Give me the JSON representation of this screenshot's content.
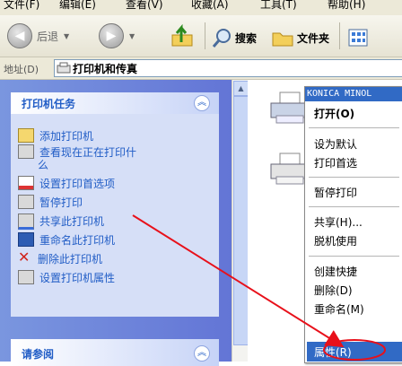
{
  "menu": {
    "file": "文件(F)",
    "edit": "编辑(E)",
    "view": "查看(V)",
    "favorites": "收藏(A)",
    "tools": "工具(T)",
    "help": "帮助(H)"
  },
  "toolbar": {
    "back": "后退",
    "search": "搜索",
    "folders": "文件夹"
  },
  "address": {
    "label": "地址(D)",
    "value": "打印机和传真"
  },
  "tasks": {
    "title": "打印机任务",
    "items": [
      {
        "label": "添加打印机"
      },
      {
        "label": "查看现在正在打印什"
      },
      {
        "label": "么"
      },
      {
        "label": "设置打印首选项"
      },
      {
        "label": "暂停打印"
      },
      {
        "label": "共享此打印机"
      },
      {
        "label": "重命名此打印机"
      },
      {
        "label": "删除此打印机"
      },
      {
        "label": "设置打印机属性"
      }
    ]
  },
  "seealso": {
    "title": "请参阅"
  },
  "context_menu": {
    "title": "KONICA MINOL",
    "items": [
      {
        "label": "打开(O)"
      },
      {
        "label": "设为默认"
      },
      {
        "label": "打印首选"
      },
      {
        "label": "暂停打印"
      },
      {
        "label": "共享(H)..."
      },
      {
        "label": "脱机使用"
      },
      {
        "label": "创建快捷"
      },
      {
        "label": "删除(D)"
      },
      {
        "label": "重命名(M)"
      },
      {
        "label": "属性(R)"
      }
    ]
  },
  "annotation_color": "#e8101a"
}
